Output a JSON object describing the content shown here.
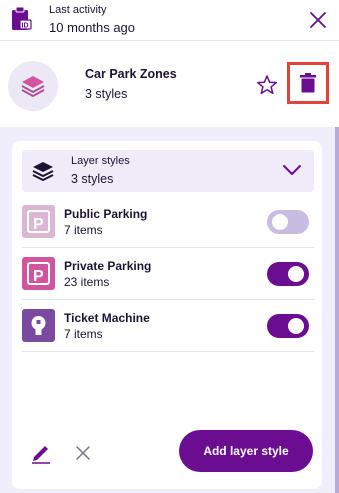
{
  "colors": {
    "primary": "#6a0d91",
    "delete_highlight": "#e0433a",
    "toggle_off": "#c8bce3",
    "badge_public": "#dcb7d3",
    "badge_private": "#d0559e",
    "badge_ticket": "#7a4aa0"
  },
  "header": {
    "icon": "clipboard-id-icon",
    "label": "Last activity",
    "value": "10 months ago",
    "close_icon": "close-icon"
  },
  "layer": {
    "icon": "layers-icon",
    "name": "Car Park Zones",
    "subtitle": "3 styles",
    "favorite_icon": "star-outline-icon",
    "delete_icon": "trash-icon"
  },
  "layer_styles": {
    "title": "Layer styles",
    "count": "3 styles",
    "expand_icon": "chevron-down-icon",
    "items": [
      {
        "name": "Public Parking",
        "count": "7 items",
        "icon": "parking-p-icon",
        "enabled": false
      },
      {
        "name": "Private Parking",
        "count": "23 items",
        "icon": "parking-p-icon",
        "enabled": true
      },
      {
        "name": "Ticket Machine",
        "count": "7 items",
        "icon": "ticket-machine-icon",
        "enabled": true
      }
    ]
  },
  "footer": {
    "edit_icon": "pencil-icon",
    "cancel_icon": "close-icon",
    "add_label": "Add layer style"
  }
}
